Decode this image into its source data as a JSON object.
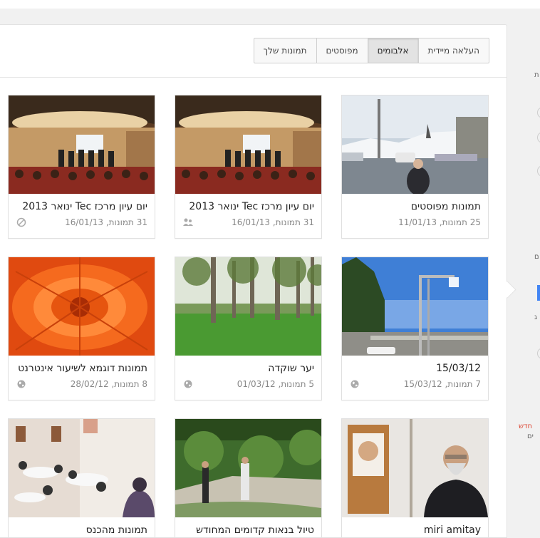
{
  "tabs": [
    {
      "label": "העלאה מיידית",
      "active": false
    },
    {
      "label": "אלבומים",
      "active": true
    },
    {
      "label": "מפוסטים",
      "active": false
    },
    {
      "label": "תמונות שלך",
      "active": false
    }
  ],
  "albums": [
    {
      "title": "תמונות מפוסטים",
      "meta": "25 תמונות, 11/01/13",
      "privacy_icon": "none"
    },
    {
      "title": "יום עיון מרכז Tec ינואר 2013",
      "meta": "31 תמונות, 16/01/13",
      "privacy_icon": "people-icon"
    },
    {
      "title": "יום עיון מרכז Tec ינואר 2013",
      "meta": "31 תמונות, 16/01/13",
      "privacy_icon": "blocked-icon"
    },
    {
      "title": "15/03/12",
      "meta": "7 תמונות, 15/03/12",
      "privacy_icon": "globe-icon"
    },
    {
      "title": "יער שוקדה",
      "meta": "5 תמונות, 01/03/12",
      "privacy_icon": "globe-icon"
    },
    {
      "title": "תמונות דוגמא לשיעור אינטרנט",
      "meta": "8 תמונות, 28/02/12",
      "privacy_icon": "globe-icon"
    },
    {
      "title": "miri amitay",
      "meta": "",
      "privacy_icon": "none"
    },
    {
      "title": "טיול בנאות קדומים המחודש",
      "meta": "",
      "privacy_icon": "none"
    },
    {
      "title": "תמונות מהכנס",
      "meta": "",
      "privacy_icon": "none"
    }
  ],
  "right_column": {
    "fragment_1": "ת",
    "fragment_2": "ם",
    "fragment_3": "ג",
    "new_label": "חדש",
    "fragment_4": "ים"
  },
  "colors": {
    "new_label": "#dd4b39",
    "active_tab": "#e3e3e3",
    "panel_border": "#e2e2e2"
  }
}
